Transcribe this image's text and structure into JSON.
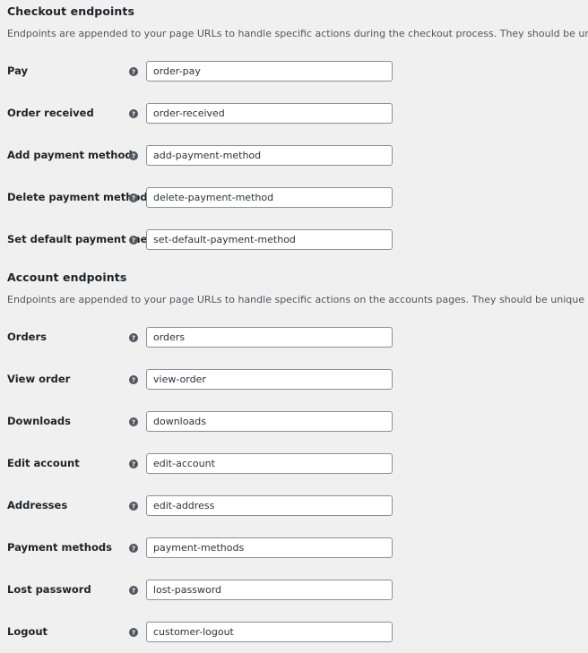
{
  "sections": [
    {
      "id": "checkout-endpoints",
      "heading": "Checkout endpoints",
      "description": "Endpoints are appended to your page URLs to handle specific actions during the checkout process. They should be unique.",
      "rows": [
        {
          "label": "Pay",
          "value": "order-pay",
          "help_icon": "help-circle-icon"
        },
        {
          "label": "Order received",
          "value": "order-received",
          "help_icon": "help-circle-icon"
        },
        {
          "label": "Add payment method",
          "value": "add-payment-method",
          "help_icon": "help-circle-icon"
        },
        {
          "label": "Delete payment method",
          "value": "delete-payment-method",
          "help_icon": "help-circle-icon"
        },
        {
          "label": "Set default payment method",
          "value": "set-default-payment-method",
          "help_icon": "help-circle-icon"
        }
      ]
    },
    {
      "id": "account-endpoints",
      "heading": "Account endpoints",
      "description": "Endpoints are appended to your page URLs to handle specific actions on the accounts pages. They should be unique and can be left blank to disable the endpoint",
      "rows": [
        {
          "label": "Orders",
          "value": "orders",
          "help_icon": "help-circle-icon"
        },
        {
          "label": "View order",
          "value": "view-order",
          "help_icon": "help-circle-icon"
        },
        {
          "label": "Downloads",
          "value": "downloads",
          "help_icon": "help-circle-icon"
        },
        {
          "label": "Edit account",
          "value": "edit-account",
          "help_icon": "help-circle-icon"
        },
        {
          "label": "Addresses",
          "value": "edit-address",
          "help_icon": "help-circle-icon"
        },
        {
          "label": "Payment methods",
          "value": "payment-methods",
          "help_icon": "help-circle-icon"
        },
        {
          "label": "Lost password",
          "value": "lost-password",
          "help_icon": "help-circle-icon"
        },
        {
          "label": "Logout",
          "value": "customer-logout",
          "help_icon": "help-circle-icon"
        }
      ]
    }
  ],
  "colors": {
    "page_background": "#f0f0f1",
    "heading_text": "#1d2327",
    "description_text": "#50575e",
    "input_border": "#8c8f94",
    "input_background": "#ffffff",
    "input_text": "#2c3338",
    "help_icon": "#50575e"
  }
}
